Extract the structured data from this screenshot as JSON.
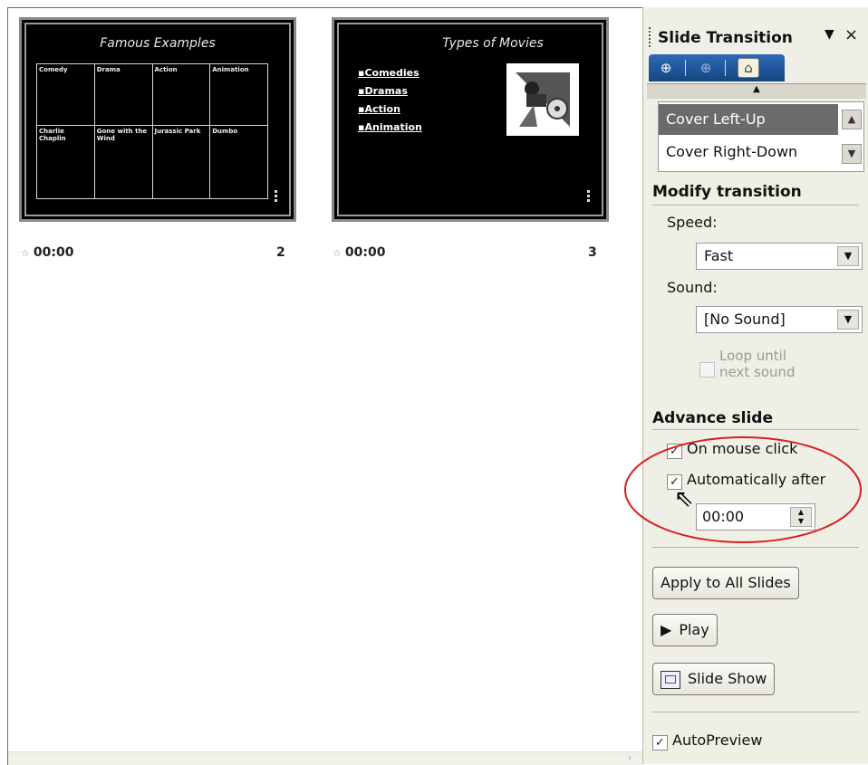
{
  "slides": [
    {
      "title": "Famous Examples",
      "table": [
        [
          "Comedy",
          "Drama",
          "Action",
          "Animation"
        ],
        [
          "Charlie Chaplin",
          "Gone with the Wind",
          "Jurassic Park",
          "Dumbo"
        ]
      ],
      "time": "00:00",
      "number": "2"
    },
    {
      "title": "Types of Movies",
      "bullets": [
        "Comedies",
        "Dramas",
        "Action",
        "Animation"
      ],
      "time": "00:00",
      "number": "3"
    }
  ],
  "pane": {
    "title": "Slide Transition",
    "dropdown_icon": "triangle-down-icon",
    "close_label": "×",
    "transitions": [
      "Cover Left-Up",
      "Cover Right-Down"
    ],
    "selected_transition": "Cover Left-Up",
    "modify": {
      "heading": "Modify transition",
      "speed_label": "Speed:",
      "speed_value": "Fast",
      "sound_label": "Sound:",
      "sound_value": "[No Sound]",
      "loop_label_line1": "Loop until",
      "loop_label_line2": "next sound",
      "loop_checked": false
    },
    "advance": {
      "heading": "Advance slide",
      "mouse_click_label": "On mouse click",
      "mouse_click_checked": true,
      "auto_label": "Automatically after",
      "auto_checked": true,
      "auto_value": "00:00"
    },
    "buttons": {
      "apply_all": "Apply to All Slides",
      "play": "Play",
      "slide_show": "Slide Show"
    },
    "autopreview_label": "AutoPreview",
    "autopreview_checked": true,
    "highlight_color": "#d62020"
  }
}
